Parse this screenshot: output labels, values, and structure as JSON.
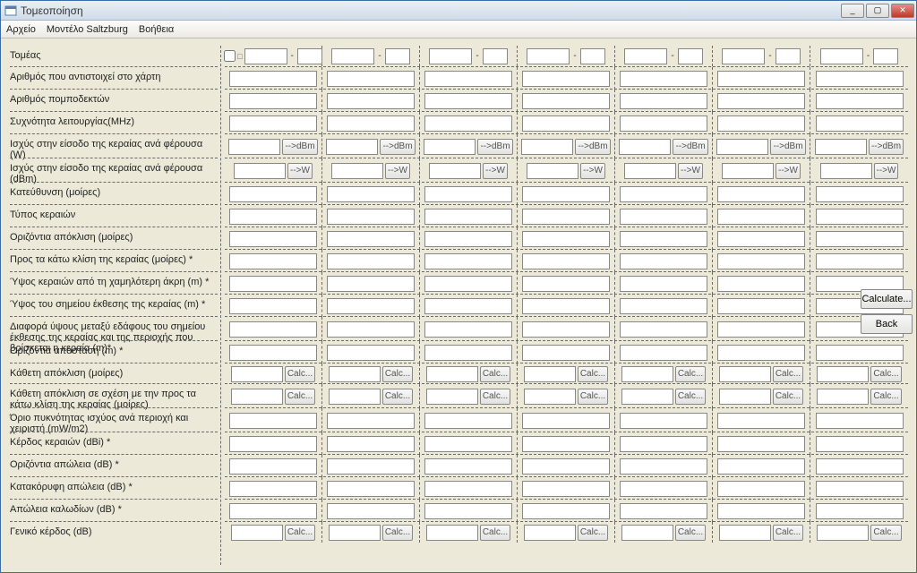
{
  "window": {
    "title": "Τομεοποίηση"
  },
  "menu": {
    "file": "Αρχείο",
    "model": "Μοντέλο Saltzburg",
    "help": "Βοήθεια"
  },
  "labels": {
    "sector": "Τομέας",
    "map_number": "Αριθμός που αντιστοιχεί στο χάρτη",
    "transceivers": "Αριθμός πομποδεκτών",
    "freq": "Συχνότητα λειτουργίας(MHz)",
    "pw_w": "Ισχύς στην είσοδο της κεραίας ανά φέρουσα (W)",
    "pw_dbm": "Ισχύς στην είσοδο της κεραίας ανά φέρουσα (dBm)",
    "dir": "Κατεύθυνση (μοίρες)",
    "ant_type": "Τύπος κεραιών",
    "h_dev": "Οριζόντια απόκλιση (μοίρες)",
    "down_tilt": "Προς τα κάτω κλίση της κεραίας (μοίρες) *",
    "h_low": "Ύψος κεραιών από τη χαμηλότερη άκρη (m) *",
    "h_exp": "Ύψος του σημείου έκθεσης της κεραίας (m) *",
    "dh": "Διαφορά ύψους μεταξύ εδάφους του σημείου έκθεσης της κεραίας και της περιοχής που βρίσκεται η κεραία (m)*",
    "h_dist": "Οριζόντια απόσταση (m) *",
    "v_dev": "Κάθετη απόκλιση (μοίρες)",
    "v_dev_rel": "Κάθετη απόκλιση σε σχέση με την προς τα κάτω κλίση της κεραίας (μοίρες)",
    "limit": "Όριο πυκνότητας ισχύος ανά περιοχή και χειριστή (mW/m2)",
    "gain": "Κέρδος κεραιών (dBi) *",
    "h_loss": "Οριζόντια απώλεια (dB) *",
    "v_loss": "Κατακόρυφη απώλεια (dB) *",
    "c_loss": "Απώλεια καλωδίων (dB) *",
    "total_gain": "Γενικό κέρδος (dB)"
  },
  "btn": {
    "to_dbm": "-->dBm",
    "to_w": "-->W",
    "calc": "Calc...",
    "calculate": "Calculate...",
    "back": "Back",
    "dash": "-"
  },
  "cols": 7,
  "row_heights": {
    "sector": 23,
    "map_number": 25,
    "transceivers": 25,
    "freq": 25,
    "pw_w": 27,
    "pw_dbm": 27,
    "dir": 25,
    "ant_type": 25,
    "h_dev": 25,
    "down_tilt": 25,
    "h_low": 25,
    "h_exp": 25,
    "dh": 27,
    "h_dist": 25,
    "v_dev": 23,
    "v_dev_rel": 27,
    "limit": 27,
    "gain": 25,
    "h_loss": 25,
    "v_loss": 25,
    "c_loss": 25,
    "total_gain": 23
  },
  "row_kind": {
    "sector": "header",
    "map_number": "plain",
    "transceivers": "plain",
    "freq": "plain",
    "pw_w": "dbm",
    "pw_dbm": "w",
    "dir": "plain",
    "ant_type": "plain",
    "h_dev": "plain",
    "down_tilt": "plain",
    "h_low": "plain",
    "h_exp": "plain",
    "dh": "plain",
    "h_dist": "plain",
    "v_dev": "calc",
    "v_dev_rel": "calc",
    "limit": "plain",
    "gain": "plain",
    "h_loss": "plain",
    "v_loss": "plain",
    "c_loss": "plain",
    "total_gain": "calc"
  },
  "order": [
    "sector",
    "map_number",
    "transceivers",
    "freq",
    "pw_w",
    "pw_dbm",
    "dir",
    "ant_type",
    "h_dev",
    "down_tilt",
    "h_low",
    "h_exp",
    "dh",
    "h_dist",
    "v_dev",
    "v_dev_rel",
    "limit",
    "gain",
    "h_loss",
    "v_loss",
    "c_loss",
    "total_gain"
  ]
}
